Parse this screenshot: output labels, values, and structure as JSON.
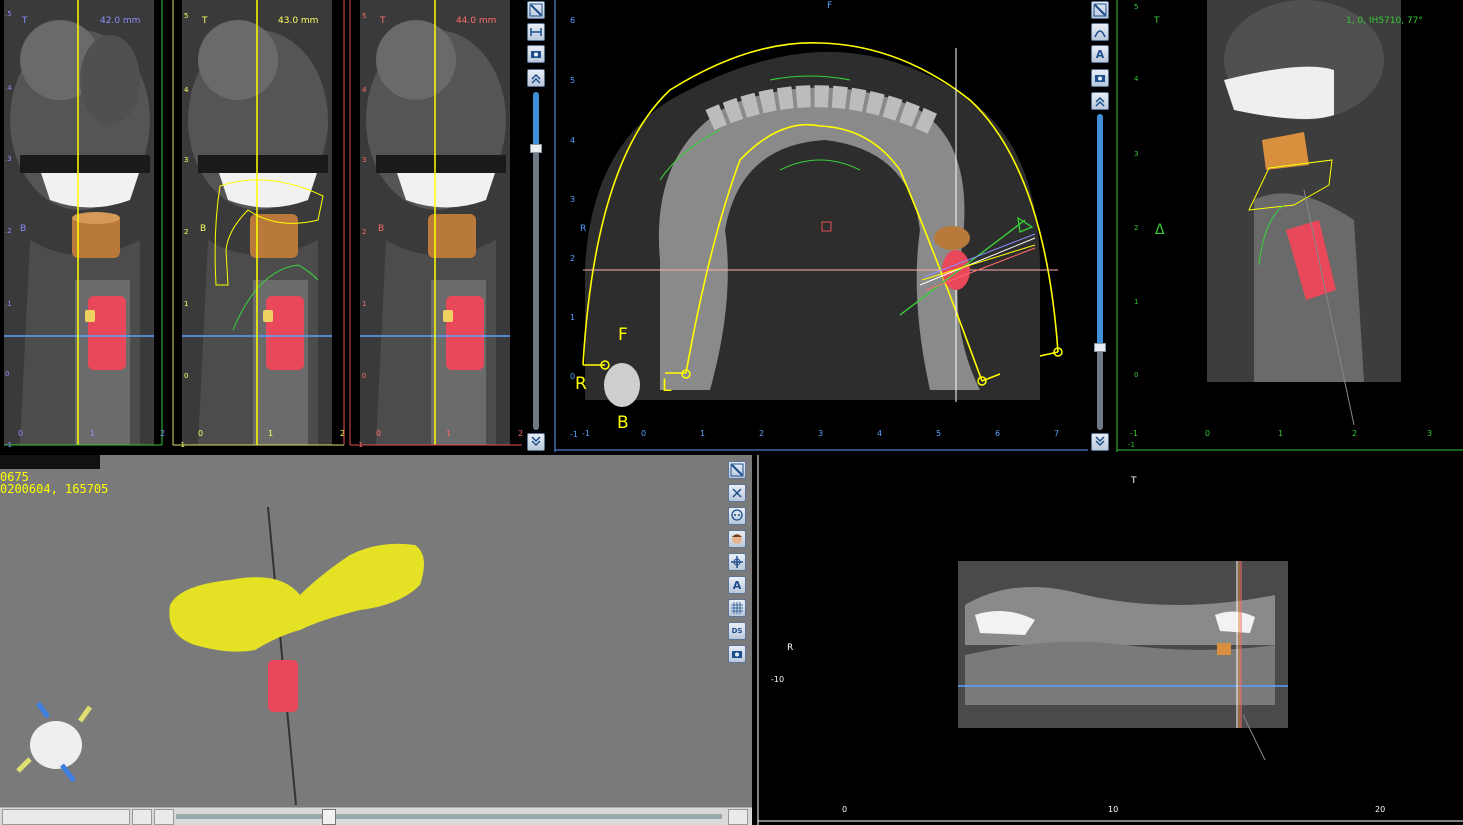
{
  "cross_sections": [
    {
      "title_letter": "T",
      "side_letter": "B",
      "distance": "42.0 mm",
      "color": "#8c8cff",
      "ruler_labels": [
        ".5",
        ".4",
        ".3",
        ".2",
        ".1",
        "0",
        "-1"
      ],
      "x_labels": [
        "0",
        "1",
        "2"
      ]
    },
    {
      "title_letter": "T",
      "side_letter": "B",
      "distance": "43.0 mm",
      "color": "#ffff66",
      "ruler_labels": [
        "5",
        "4",
        "3",
        "2",
        "1",
        "0",
        "-1"
      ],
      "x_labels": [
        "0",
        "1",
        "2"
      ]
    },
    {
      "title_letter": "T",
      "side_letter": "B",
      "distance": "44.0 mm",
      "color": "#ff6b6b",
      "ruler_labels": [
        "5",
        "4",
        "3",
        "2",
        "1",
        "0",
        "-1"
      ],
      "x_labels": [
        "0",
        "1",
        "2"
      ]
    }
  ],
  "axial": {
    "top_letter": "F",
    "left_letter": "R",
    "ruler_labels": [
      "6",
      "5",
      "4",
      "3",
      "2",
      "1",
      "0",
      "-1"
    ],
    "x_labels": [
      "-1",
      "0",
      "1",
      "2",
      "3",
      "4",
      "5",
      "6",
      "7"
    ],
    "curve_labels": {
      "front": "F",
      "right": "R",
      "left": "L",
      "back": "B"
    }
  },
  "sagittal": {
    "title_letter": "T",
    "implant_info": "1, 0, IH5710, 77°",
    "delta_symbol": "Δ",
    "ruler_labels": [
      "5",
      "4",
      "3",
      "2",
      "1",
      "0",
      "-1"
    ],
    "x_labels": [
      "-1",
      "0",
      "1",
      "2",
      "3"
    ]
  },
  "view3d": {
    "info_line1": "0675",
    "info_line2": "0200604, 165705",
    "toolbar": [
      "select",
      "cut",
      "skull",
      "face",
      "axes",
      "annotate",
      "grid",
      "ds",
      "snapshot"
    ],
    "toolbar_text": {
      "annotate": "A",
      "ds": "DS"
    }
  },
  "panoramic": {
    "top_letter": "T",
    "left_letter": "R",
    "ruler_label": "-10",
    "x_labels": [
      "0",
      "10",
      "20"
    ]
  },
  "colors": {
    "yellow_curve": "#ffff00",
    "green_nerve": "#3bd13b",
    "implant": "#e8485a",
    "abutment": "#e0903a",
    "ruler_green": "#36c836",
    "ruler_red": "#e05050",
    "crosshair_blue": "#5aa0ff"
  }
}
